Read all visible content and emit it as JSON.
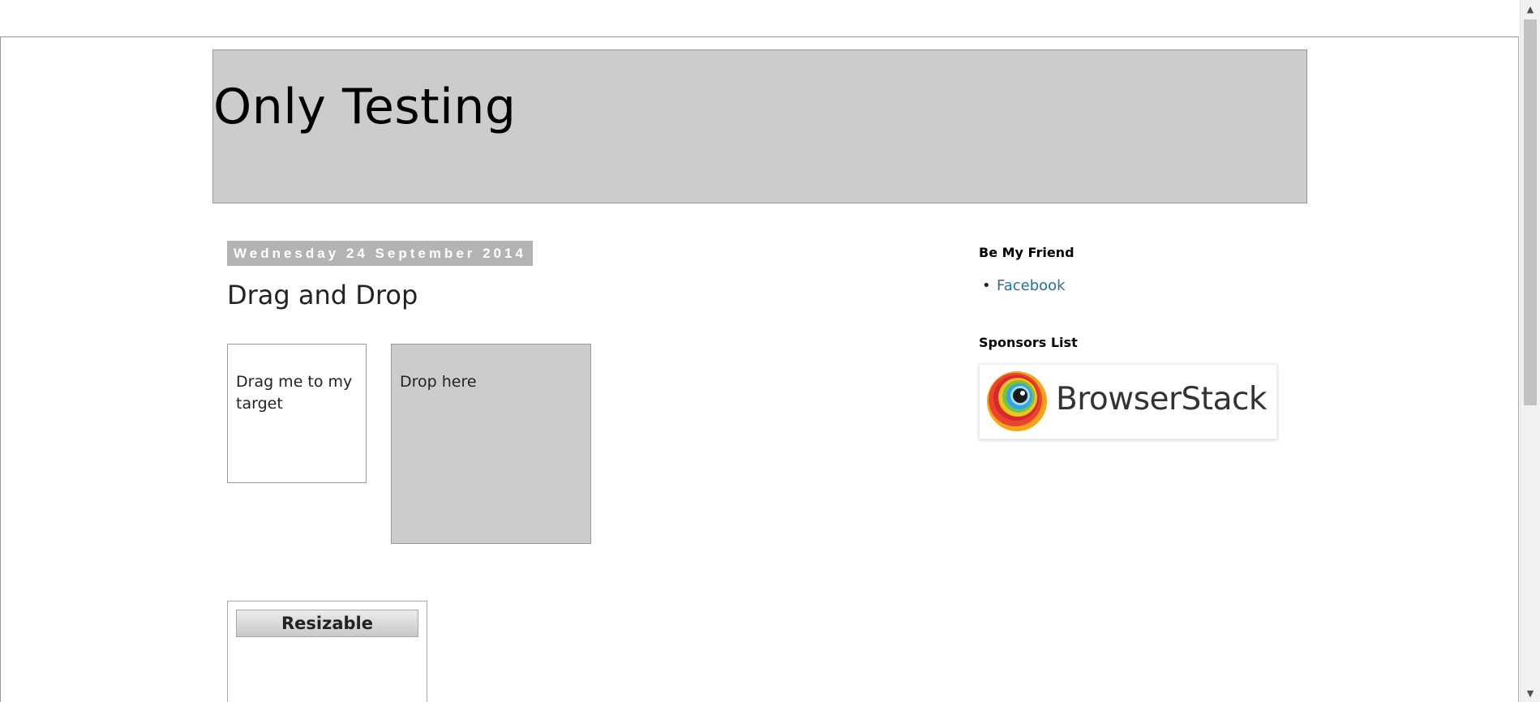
{
  "blog": {
    "title": "Only Testing"
  },
  "post": {
    "date": "Wednesday 24 September 2014",
    "title": "Drag and Drop",
    "draggable_text": "Drag me to my target",
    "droppable_text": "Drop here",
    "resizable_title": "Resizable"
  },
  "sidebar": {
    "friend_heading": "Be My Friend",
    "friend_links": [
      {
        "label": "Facebook"
      }
    ],
    "sponsors_heading": "Sponsors List",
    "sponsor": {
      "name": "BrowserStack",
      "logo_icon": "browserstack-eye-icon"
    }
  },
  "colors": {
    "header_bg": "#cccccc",
    "date_bg": "#b3b3b3",
    "link": "#2a6f9e",
    "drop_bg": "#cccccc"
  },
  "scrollbar": {
    "up_icon": "scroll-up-arrow-icon",
    "down_icon": "scroll-down-arrow-icon"
  }
}
